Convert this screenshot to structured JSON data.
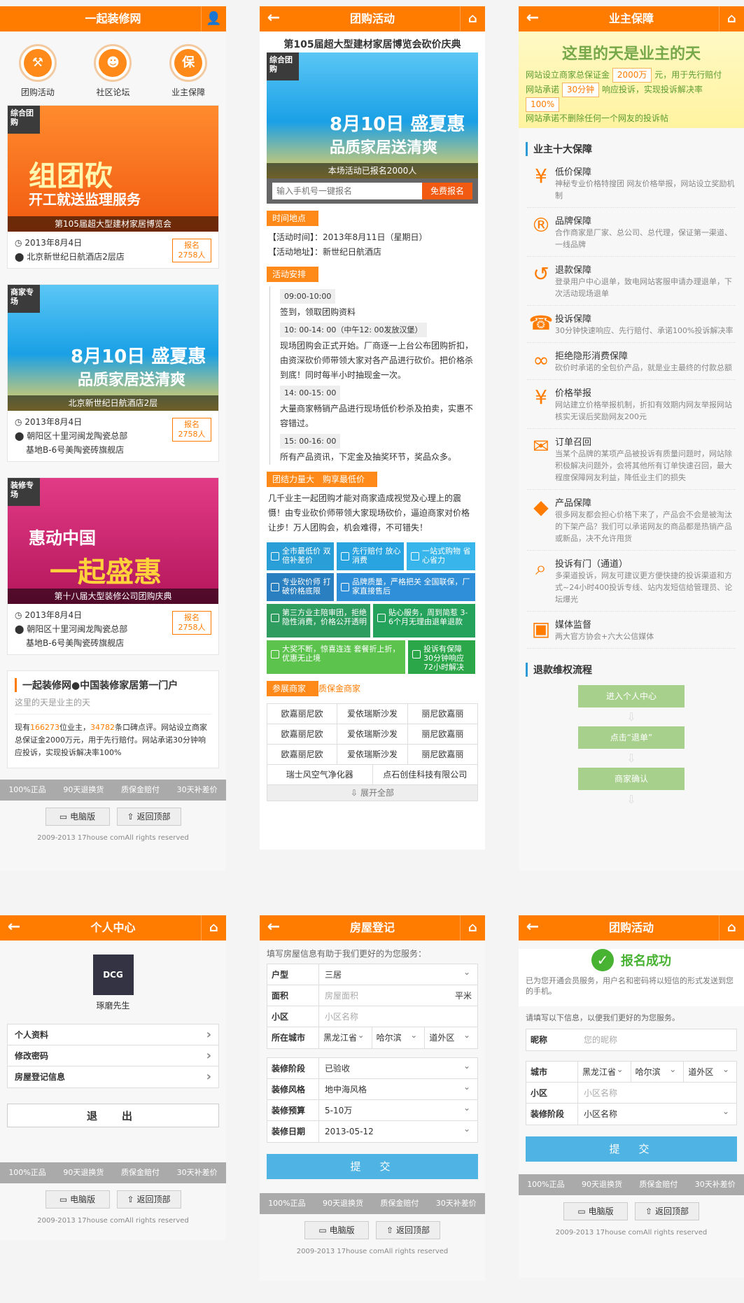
{
  "p1": {
    "title": "一起装修网",
    "tabs": [
      "团购活动",
      "社区论坛",
      "业主保障"
    ],
    "cards": [
      {
        "corner": "综合团购",
        "big": "组团砍",
        "big2": "开工就送监理服务",
        "cap": "第105届超大型建材家居博览会",
        "date": "2013年8月4日",
        "addr": "北京新世纪日航酒店2层店",
        "addr2": "",
        "badge1": "报名",
        "badge2": "2758人"
      },
      {
        "corner": "商家专场",
        "big": "8月10日 盛夏惠",
        "big2": "品质家居送清爽",
        "cap": "北京新世纪日航酒店2层",
        "date": "2013年8月4日",
        "addr": "朝阳区十里河闽龙陶瓷总部",
        "addr2": "基地B-6号美陶瓷砖旗舰店",
        "badge1": "报名",
        "badge2": "2758人"
      },
      {
        "corner": "装修专场",
        "big": "惠动中国",
        "big2": "一起盛惠",
        "cap": "第十八届大型装修公司团购庆典",
        "date": "2013年8月4日",
        "addr": "朝阳区十里河闽龙陶瓷总部",
        "addr2": "基地B-6号美陶瓷砖旗舰店",
        "badge1": "报名",
        "badge2": "2758人"
      }
    ],
    "intro": {
      "title": "一起装修网●中国装修家居第一门户",
      "sub": "这里的天是业主的天",
      "pre": "现有",
      "n1": "166273",
      "mid": "位业主，",
      "n2": "34782",
      "post": "条口碑点评。网站设立商家总保证金2000万元，用于先行赔付。网站承诺30分钟响应投诉，实现投诉解决率100%"
    }
  },
  "footer": {
    "items": [
      "100%正品",
      "90天退换货",
      "质保金赔付",
      "30天补差价"
    ],
    "pc": "电脑版",
    "top": "返回顶部",
    "copy": "2009-2013 17house comAll rights reserved"
  },
  "p2": {
    "title": "团购活动",
    "headline": "第105届超大型建材家居博览会砍价庆典",
    "cap": "本场活动已报名2000人",
    "phone_ph": "输入手机号一键报名",
    "free": "免费报名",
    "s1": "时间地点",
    "time": "【活动时间】：2013年8月11日（星期日）",
    "place": "【活动地址】：新世纪日航酒店",
    "s2": "活动安排",
    "sched": [
      {
        "t": "09:00-10:00",
        "d": "签到，领取团购资料"
      },
      {
        "t": "10: 00-14: 00（中午12: 00发放汉堡）",
        "d": "现场团购会正式开始。厂商逐一上台公布团购折扣，由资深砍价师带领大家对各产品进行砍价。把价格杀到底！同时每半小时抽现金一次。"
      },
      {
        "t": "14: 00-15: 00",
        "d": "大量商家畅销产品进行现场低价秒杀及拍卖，实惠不容错过。"
      },
      {
        "t": "15: 00-16: 00",
        "d": "所有产品资讯，下定金及抽奖环节，奖品众多。"
      }
    ],
    "s3": "团结力量大　购享最低价",
    "para": "几千业主一起团购才能对商家造成视觉及心理上的震慑！由专业砍价师带领大家现场砍价，逼迫商家对价格让步！万人团购会，机会难得，不可错失！",
    "feat": [
      "全市最低价 双倍补差价",
      "先行赔付 放心消费",
      "一站式购物 省心省力",
      "专业砍价师 打破价格底限",
      "品牌质量，严格把关 全国联保，厂家直接售后",
      "第三方业主陪审团，拒绝隐性消费，价格公开透明",
      "贴心服务，周到简惹 3-6个月无理由退单退款",
      "大奖不断，惊喜连连 套餐折上折，优惠无止境",
      "投诉有保障 30分钟响应 72小时解决"
    ],
    "s4": "参展商家",
    "s4b": "质保金商家",
    "brands": [
      [
        "欧嘉丽尼欧",
        "爱依瑞斯沙发",
        "丽尼欧嘉丽"
      ],
      [
        "欧嘉丽尼欧",
        "爱依瑞斯沙发",
        "丽尼欧嘉丽"
      ],
      [
        "欧嘉丽尼欧",
        "爱依瑞斯沙发",
        "丽尼欧嘉丽"
      ],
      [
        "瑞士风空气净化器",
        "点石创佳科技有限公司"
      ]
    ],
    "expand": "展开全部"
  },
  "p3": {
    "title": "业主保障",
    "yb": "这里的天是业主的天",
    "y1a": "网站设立商家总保证金",
    "y1b": "2000万",
    "y1c": "元，用于先行赔付",
    "y2a": "网站承诺",
    "y2b": "30分钟",
    "y2c": "响应投诉，实现投诉解决率",
    "y2d": "100%",
    "y3": "网站承诺不删除任何一个网友的投诉帖",
    "h1": "业主十大保障",
    "g": [
      {
        "i": "¥",
        "t": "低价保障",
        "d": "神秘专业价格特搜团 网友价格举报，网站设立奖励机制"
      },
      {
        "i": "®",
        "t": "品牌保障",
        "d": "合作商家是厂家、总公司、总代理，保证第一渠道、一线品牌"
      },
      {
        "i": "↺",
        "t": "退款保障",
        "d": "登录用户中心退单，致电网站客服申请办理退单，下次活动现场退单"
      },
      {
        "i": "☎",
        "t": "投诉保障",
        "d": "30分钟快速响应、先行赔付、承诺100%投诉解决率"
      },
      {
        "i": "∞",
        "t": "拒绝隐形消费保障",
        "d": "砍价时承诺的全包价产品，就是业主最终的付款总额"
      },
      {
        "i": "¥",
        "t": "价格举报",
        "d": "网站建立价格举报机制，折扣有效期内网友举报网站核实无误后奖励网友200元"
      },
      {
        "i": "✉",
        "t": "订单召回",
        "d": "当某个品牌的某项产品被投诉有质量问题时，网站除积极解决问题外，会将其他所有订单快速召回，最大程度保障网友利益，降低业主们的损失"
      },
      {
        "i": "◆",
        "t": "产品保障",
        "d": "很多网友都会担心价格下来了，产品会不会是被淘汰的下架产品？我们可以承诺网友的商品都是热销产品或新品，决不允许甩货"
      },
      {
        "i": "⌕",
        "t": "投诉有门（通道）",
        "d": "多渠道投诉，网友可建议更方便快捷的投诉渠道和方式~24小时400投诉专线、站内发短信给管理员、论坛爆光"
      },
      {
        "i": "▣",
        "t": "媒体监督",
        "d": "两大官方协会+六大公信媒体"
      }
    ],
    "h2": "退款维权流程",
    "steps": [
      "进入个人中心",
      "点击“退单”",
      "商家确认"
    ]
  },
  "p4": {
    "title": "个人中心",
    "name": "琢磨先生",
    "avatar": "DCG",
    "menu": [
      "个人资料",
      "修改密码",
      "房屋登记信息"
    ],
    "logout": "退　出"
  },
  "p5": {
    "title": "房屋登记",
    "hint": "填写房屋信息有助于我们更好的为您服务：",
    "f1": [
      {
        "l": "户型",
        "v": "三居",
        "ph": false,
        "sel": true
      },
      {
        "l": "面积",
        "v": "房屋面积",
        "ph": true,
        "sel": false,
        "unit": "平米"
      },
      {
        "l": "小区",
        "v": "小区名称",
        "ph": true,
        "sel": false
      }
    ],
    "city_l": "所在城市",
    "cities": [
      "黑龙江省",
      "哈尔滨",
      "道外区"
    ],
    "f2": [
      {
        "l": "装修阶段",
        "v": "已验收"
      },
      {
        "l": "装修风格",
        "v": "地中海风格"
      },
      {
        "l": "装修预算",
        "v": "5-10万"
      },
      {
        "l": "装修日期",
        "v": "2013-05-12"
      }
    ],
    "submit": "提　交"
  },
  "p6": {
    "title": "团购活动",
    "ok": "报名成功",
    "okd": "已为您开通会员服务，用户名和密码将以短信的形式发送到您的手机。",
    "hint": "请填写以下信息，以便我们更好的为您服务。",
    "nick_l": "昵称",
    "nick_ph": "您的昵称",
    "city_l": "城市",
    "cities": [
      "黑龙江省",
      "哈尔滨",
      "道外区"
    ],
    "comm_l": "小区",
    "comm_ph": "小区名称",
    "stage_l": "装修阶段",
    "stage_v": "小区名称",
    "submit": "提　交"
  }
}
